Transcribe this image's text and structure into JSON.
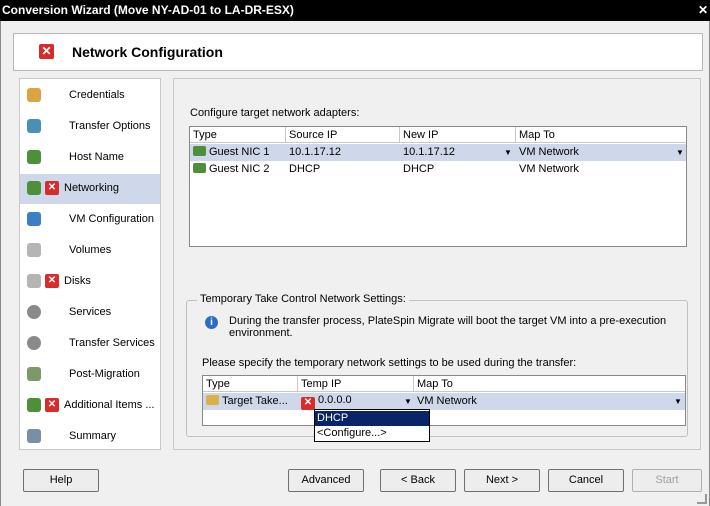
{
  "window": {
    "title": "Conversion Wizard (Move NY-AD-01 to LA-DR-ESX)",
    "close_glyph": "✕"
  },
  "header": {
    "title": "Network Configuration",
    "icon": "error-icon"
  },
  "sidebar": {
    "items": [
      {
        "label": "Credentials",
        "icon": "credentials-icon",
        "error": false,
        "active": false
      },
      {
        "label": "Transfer Options",
        "icon": "transfer-options-icon",
        "error": false,
        "active": false
      },
      {
        "label": "Host Name",
        "icon": "host-name-icon",
        "error": false,
        "active": false
      },
      {
        "label": "Networking",
        "icon": "networking-icon",
        "error": true,
        "active": true
      },
      {
        "label": "VM Configuration",
        "icon": "vm-configuration-icon",
        "error": false,
        "active": false
      },
      {
        "label": "Volumes",
        "icon": "volumes-icon",
        "error": false,
        "active": false
      },
      {
        "label": "Disks",
        "icon": "disks-icon",
        "error": true,
        "active": false
      },
      {
        "label": "Services",
        "icon": "services-icon",
        "error": false,
        "active": false
      },
      {
        "label": "Transfer Services",
        "icon": "transfer-services-icon",
        "error": false,
        "active": false
      },
      {
        "label": "Post-Migration",
        "icon": "post-migration-icon",
        "error": false,
        "active": false
      },
      {
        "label": "Additional Items ...",
        "icon": "additional-items-icon",
        "error": true,
        "active": false
      },
      {
        "label": "Summary",
        "icon": "summary-icon",
        "error": false,
        "active": false
      }
    ]
  },
  "adapters": {
    "caption": "Configure target network adapters:",
    "columns": [
      "Type",
      "Source IP",
      "New IP",
      "Map To"
    ],
    "rows": [
      {
        "type": "Guest NIC 1",
        "source_ip": "10.1.17.12",
        "new_ip": "10.1.17.12",
        "map_to": "VM Network",
        "selected": true
      },
      {
        "type": "Guest NIC 2",
        "source_ip": "DHCP",
        "new_ip": "DHCP",
        "map_to": "VM Network",
        "selected": false
      }
    ]
  },
  "temp_settings": {
    "group_title": "Temporary Take Control Network Settings:",
    "info": "During the transfer process, PlateSpin Migrate will boot the target VM into a pre-execution environment.",
    "caption": "Please specify the temporary network settings to be used during the transfer:",
    "columns": [
      "Type",
      "Temp IP",
      "Map To"
    ],
    "row": {
      "type": "Target Take...",
      "temp_ip": "0.0.0.0",
      "map_to": "VM Network"
    },
    "dropdown_options": [
      "DHCP",
      "<Configure...>"
    ]
  },
  "buttons": {
    "help": "Help",
    "advanced": "Advanced",
    "back": "< Back",
    "next": "Next >",
    "cancel": "Cancel",
    "start": "Start"
  },
  "colors": {
    "selection": "#cfd8ea",
    "error_red": "#d92b2b",
    "dropdown_highlight": "#0a246a"
  }
}
